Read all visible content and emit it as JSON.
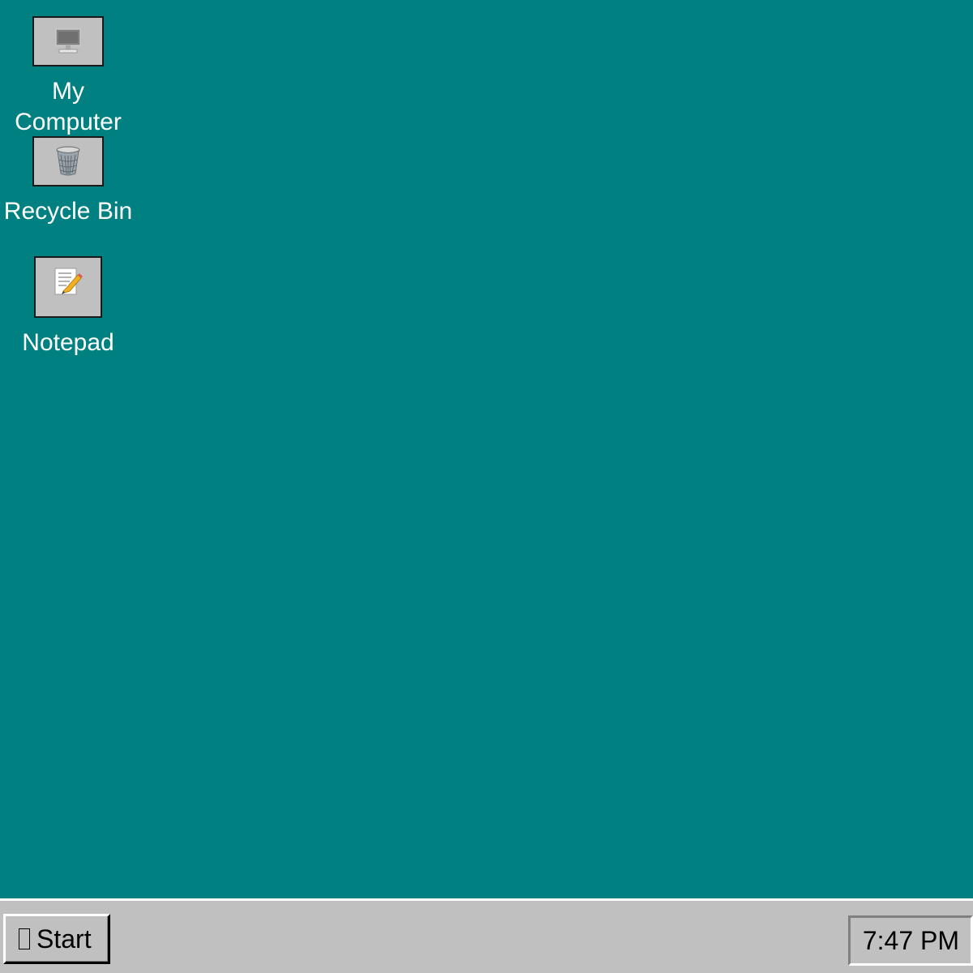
{
  "desktop": {
    "background_color": "#008080",
    "icons": [
      {
        "label": "My Computer",
        "icon": "computer-icon"
      },
      {
        "label": "Recycle Bin",
        "icon": "recycle-bin-icon"
      },
      {
        "label": "Notepad",
        "icon": "notepad-icon"
      }
    ]
  },
  "taskbar": {
    "background_color": "#c0c0c0",
    "start_label": "Start",
    "start_icon": "windows-logo-icon",
    "clock": "7:47 PM"
  }
}
